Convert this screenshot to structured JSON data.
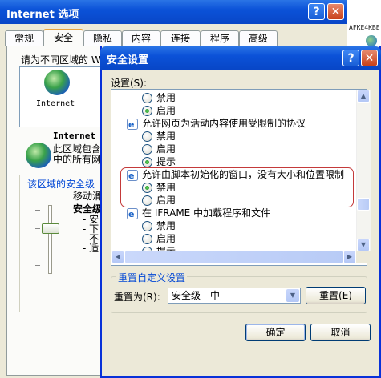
{
  "back_window": {
    "title": "Internet 选项",
    "title_buttons": [
      "?",
      "✕"
    ],
    "tabs": [
      "常规",
      "安全",
      "隐私",
      "内容",
      "连接",
      "程序",
      "高级"
    ],
    "active_tab": "安全",
    "zone_prompt": "请为不同区域的 We",
    "zone_internet_label": "Internet",
    "zone_internet_heading": "Internet",
    "zone_desc_line1": "此区域包含",
    "zone_desc_line2": "中的所有网",
    "security_level_title": "该区域的安全级",
    "security_level_sub": "移动滑",
    "security_level_name": "安全级",
    "bullets": [
      "- 安",
      "- 下",
      "- 不",
      "- 适"
    ],
    "right_strip_text": "AFKE4KBE"
  },
  "dialog": {
    "title": "安全设置",
    "title_buttons": [
      "?",
      "✕"
    ],
    "settings_label": "设置(S):",
    "tree": [
      {
        "type": "option",
        "label": "禁用",
        "selected": false
      },
      {
        "type": "option",
        "label": "启用",
        "selected": true
      },
      {
        "type": "header",
        "label": "允许网页为活动内容使用受限制的协议"
      },
      {
        "type": "option",
        "label": "禁用",
        "selected": false
      },
      {
        "type": "option",
        "label": "启用",
        "selected": false
      },
      {
        "type": "option",
        "label": "提示",
        "selected": true
      },
      {
        "type": "header",
        "label": "允许由脚本初始化的窗口，没有大小和位置限制"
      },
      {
        "type": "option",
        "label": "禁用",
        "selected": true
      },
      {
        "type": "option",
        "label": "启用",
        "selected": false
      },
      {
        "type": "header",
        "label": "在 IFRAME 中加载程序和文件"
      },
      {
        "type": "option",
        "label": "禁用",
        "selected": false
      },
      {
        "type": "option",
        "label": "启用",
        "selected": false
      },
      {
        "type": "option",
        "label": "提示",
        "selected": false
      }
    ],
    "reset_group_title": "重置自定义设置",
    "reset_to_label": "重置为(R):",
    "reset_select_value": "安全级 - 中",
    "reset_button": "重置(E)",
    "ok_button": "确定",
    "cancel_button": "取消"
  },
  "colors": {
    "title_blue": "#0b52d8",
    "group_title_blue": "#0046d5",
    "highlight_red": "#c43a3a",
    "dialog_face": "#ece9d8"
  }
}
